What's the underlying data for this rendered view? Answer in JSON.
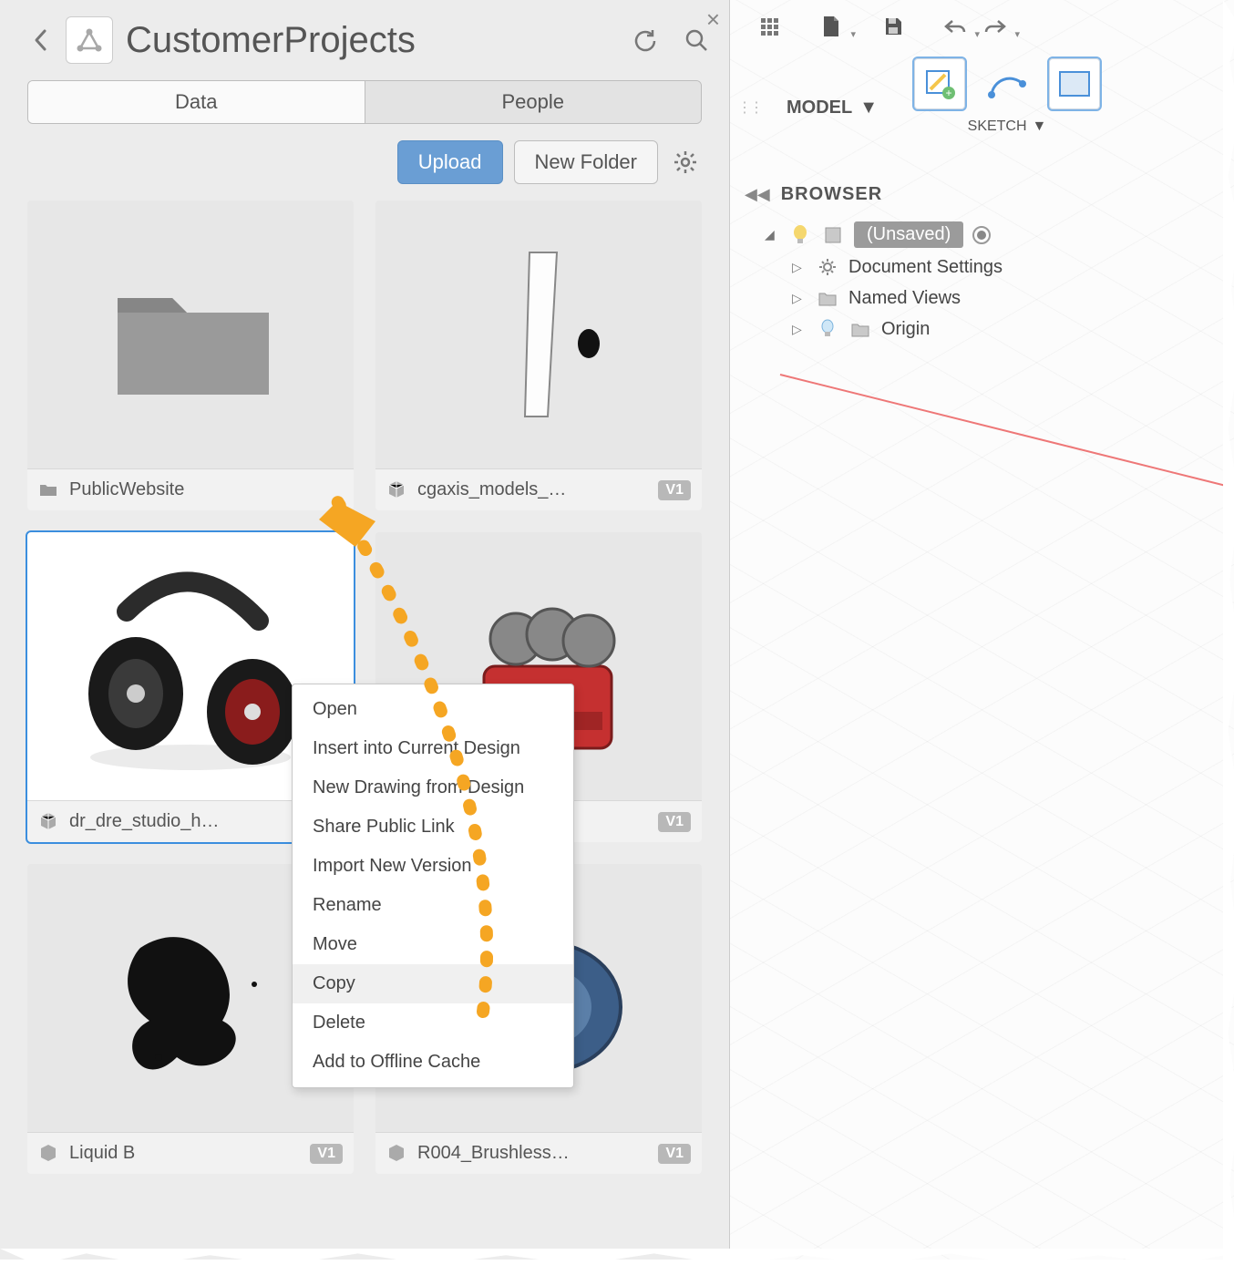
{
  "panel": {
    "title": "CustomerProjects",
    "tabs": {
      "data": "Data",
      "people": "People"
    },
    "buttons": {
      "upload": "Upload",
      "new_folder": "New Folder"
    }
  },
  "items": [
    {
      "name": "PublicWebsite",
      "type": "folder",
      "version": ""
    },
    {
      "name": "cgaxis_models_…",
      "type": "design",
      "version": "V1"
    },
    {
      "name": "dr_dre_studio_h…",
      "type": "design",
      "version": "",
      "selected": true
    },
    {
      "name": "",
      "type": "design",
      "version": "V1"
    },
    {
      "name": "Liquid B",
      "type": "design",
      "version": "V1"
    },
    {
      "name": "R004_Brushless…",
      "type": "design",
      "version": "V1"
    }
  ],
  "context_menu": {
    "items": [
      "Open",
      "Insert into Current Design",
      "New Drawing from Design",
      "Share Public Link",
      "Import New Version",
      "Rename",
      "Move",
      "Copy",
      "Delete",
      "Add to Offline Cache"
    ],
    "highlighted": "Copy"
  },
  "ribbon": {
    "workspace": "MODEL",
    "group_label": "SKETCH"
  },
  "browser": {
    "title": "BROWSER",
    "root": "(Unsaved)",
    "children": [
      "Document Settings",
      "Named Views",
      "Origin"
    ]
  }
}
